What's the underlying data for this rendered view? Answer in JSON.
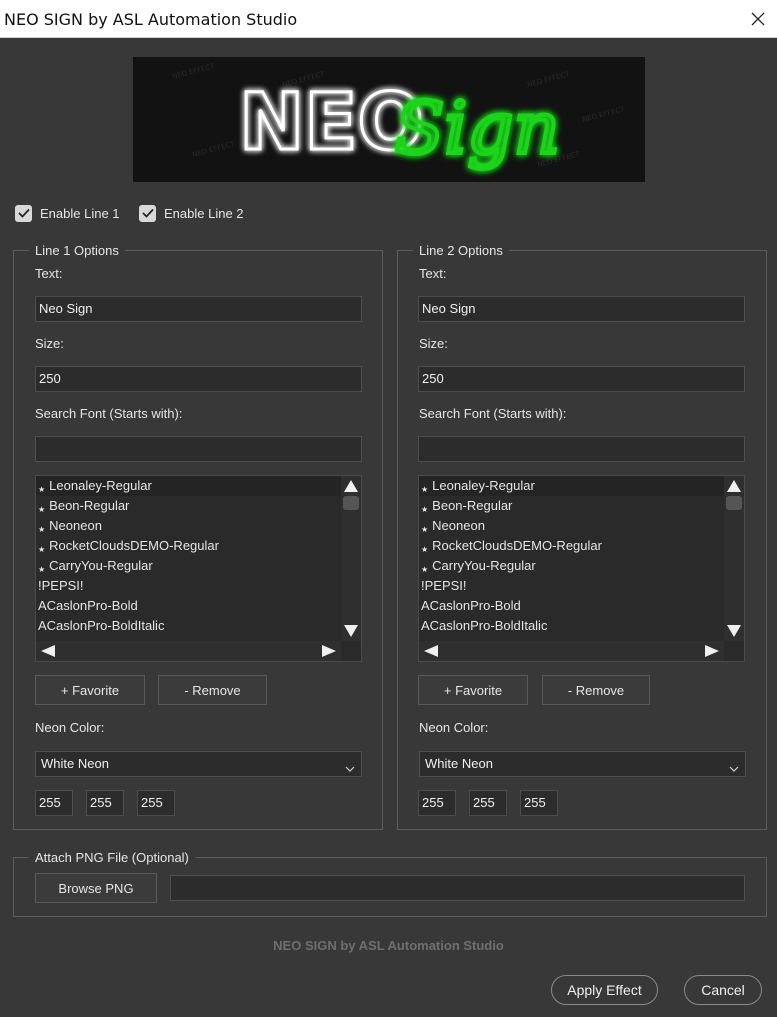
{
  "window": {
    "title": "NEO SIGN by ASL Automation Studio"
  },
  "banner": {
    "word1": "NEO",
    "word2": "Sign",
    "watermark": "NEO EFFECT",
    "color1": "#ffffff",
    "color2": "#1bd41b"
  },
  "checkboxes": [
    {
      "label": "Enable Line 1",
      "checked": true
    },
    {
      "label": "Enable Line 2",
      "checked": true
    }
  ],
  "lines": [
    {
      "group_title": "Line 1 Options",
      "text_label": "Text:",
      "text_value": "Neo Sign",
      "size_label": "Size:",
      "size_value": "250",
      "search_label": "Search Font (Starts with):",
      "search_value": "",
      "fonts": [
        {
          "name": "Leonaley-Regular",
          "fav": true,
          "selected": true
        },
        {
          "name": "Beon-Regular",
          "fav": true
        },
        {
          "name": "Neoneon",
          "fav": true
        },
        {
          "name": "RocketCloudsDEMO-Regular",
          "fav": true
        },
        {
          "name": "CarryYou-Regular",
          "fav": true
        },
        {
          "name": "!PEPSI!",
          "fav": false
        },
        {
          "name": "ACaslonPro-Bold",
          "fav": false
        },
        {
          "name": "ACaslonPro-BoldItalic",
          "fav": false
        }
      ],
      "favorite_label": "+ Favorite",
      "remove_label": "- Remove",
      "color_label": "Neon Color:",
      "color_value": "White Neon",
      "r": "255",
      "g": "255",
      "b": "255"
    },
    {
      "group_title": "Line 2 Options",
      "text_label": "Text:",
      "text_value": "Neo Sign",
      "size_label": "Size:",
      "size_value": "250",
      "search_label": "Search Font (Starts with):",
      "search_value": "",
      "fonts": [
        {
          "name": "Leonaley-Regular",
          "fav": true,
          "selected": true
        },
        {
          "name": "Beon-Regular",
          "fav": true
        },
        {
          "name": "Neoneon",
          "fav": true
        },
        {
          "name": "RocketCloudsDEMO-Regular",
          "fav": true
        },
        {
          "name": "CarryYou-Regular",
          "fav": true
        },
        {
          "name": "!PEPSI!",
          "fav": false
        },
        {
          "name": "ACaslonPro-Bold",
          "fav": false
        },
        {
          "name": "ACaslonPro-BoldItalic",
          "fav": false
        }
      ],
      "favorite_label": "+ Favorite",
      "remove_label": "- Remove",
      "color_label": "Neon Color:",
      "color_value": "White Neon",
      "r": "255",
      "g": "255",
      "b": "255"
    }
  ],
  "attach": {
    "group_title": "Attach PNG File (Optional)",
    "browse_label": "Browse PNG",
    "path_value": ""
  },
  "footer": {
    "credit": "NEO SIGN by ASL Automation Studio",
    "apply_label": "Apply Effect",
    "cancel_label": "Cancel"
  }
}
